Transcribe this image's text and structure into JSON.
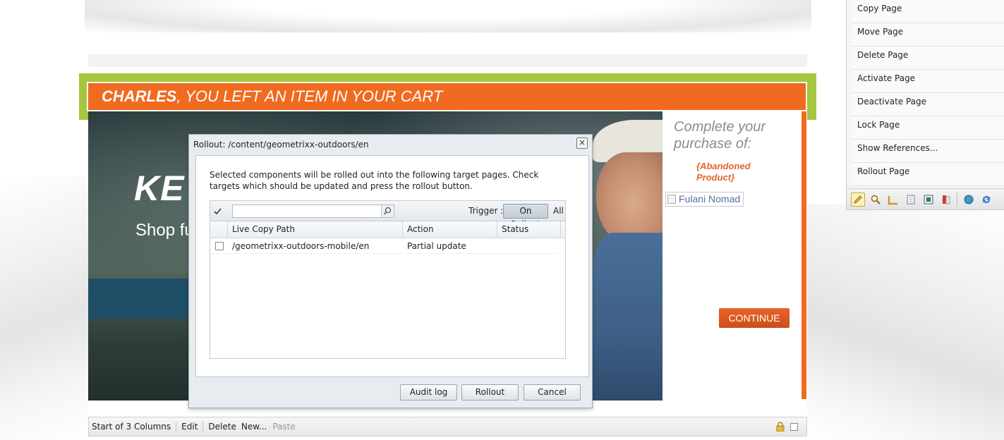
{
  "banner": {
    "name": "CHARLES",
    "message": ", YOU LEFT AN ITEM IN YOUR CART"
  },
  "hero": {
    "title": "KE",
    "subtitle": "Shop fu"
  },
  "product": {
    "complete_text": "Complete your purchase of:",
    "abandoned": "{Abandoned Product}",
    "image_alt": "Fulani Nomad",
    "continue_label": "CONTINUE"
  },
  "parsys": {
    "label": "Start of 3 Columns",
    "edit": "Edit",
    "delete": "Delete",
    "new": "New...",
    "paste": "Paste"
  },
  "sidekick": {
    "items": [
      "Copy Page",
      "Move Page",
      "Delete Page",
      "Activate Page",
      "Deactivate Page",
      "Lock Page",
      "Show References...",
      "Rollout Page"
    ],
    "tools": [
      "pencil-icon",
      "search-icon",
      "ruler-icon",
      "page-icon",
      "component-icon",
      "scaffold-icon",
      "globe-icon",
      "refresh-icon"
    ]
  },
  "dialog": {
    "title": "Rollout: /content/geometrixx-outdoors/en",
    "close_label": "×",
    "description": "Selected components will be rolled out into the following target pages. Check targets which should be updated and press the rollout button.",
    "search_value": "",
    "trigger_label": "Trigger :",
    "trigger_selected": "On Rollout",
    "trigger_all": "All",
    "columns": [
      "Live Copy Path",
      "Action",
      "Status"
    ],
    "rows": [
      {
        "path": "/geometrixx-outdoors-mobile/en",
        "action": "Partial update",
        "status": ""
      }
    ],
    "buttons": {
      "audit_log": "Audit log",
      "rollout": "Rollout",
      "cancel": "Cancel"
    }
  },
  "colors": {
    "banner_orange": "#f06a20",
    "selection_green": "#a4c640",
    "continue_orange": "#d9561f"
  }
}
